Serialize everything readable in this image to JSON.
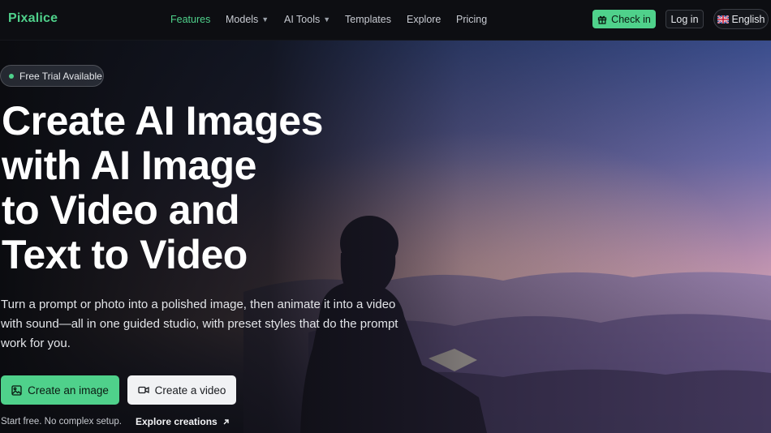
{
  "brand": {
    "name": "Pixalice",
    "accent": "#4fd18b"
  },
  "nav": {
    "links": [
      {
        "label": "Features",
        "active": true,
        "dropdown": false
      },
      {
        "label": "Models",
        "active": false,
        "dropdown": true
      },
      {
        "label": "AI Tools",
        "active": false,
        "dropdown": true
      },
      {
        "label": "Templates",
        "active": false,
        "dropdown": false
      },
      {
        "label": "Explore",
        "active": false,
        "dropdown": false
      },
      {
        "label": "Pricing",
        "active": false,
        "dropdown": false
      }
    ],
    "checkin_label": "Check in",
    "checkin_icon": "gift-icon",
    "login_label": "Log in",
    "language_label": "English",
    "language_icon": "uk-flag-icon"
  },
  "hero": {
    "badge": "Free Trial Available",
    "headline_lines": [
      "Create AI Images",
      "with AI Image",
      "to Video and",
      "Text to Video"
    ],
    "subtitle": "Turn a prompt or photo into a polished image, then animate it into a video with sound—all in one guided studio, with preset styles that do the prompt work for you.",
    "primary_cta": "Create an image",
    "primary_cta_icon": "image-icon",
    "secondary_cta": "Create a video",
    "secondary_cta_icon": "video-camera-icon",
    "footnote": "Start free. No complex setup.",
    "explore_link": "Explore creations",
    "explore_icon": "arrow-up-right-icon"
  }
}
